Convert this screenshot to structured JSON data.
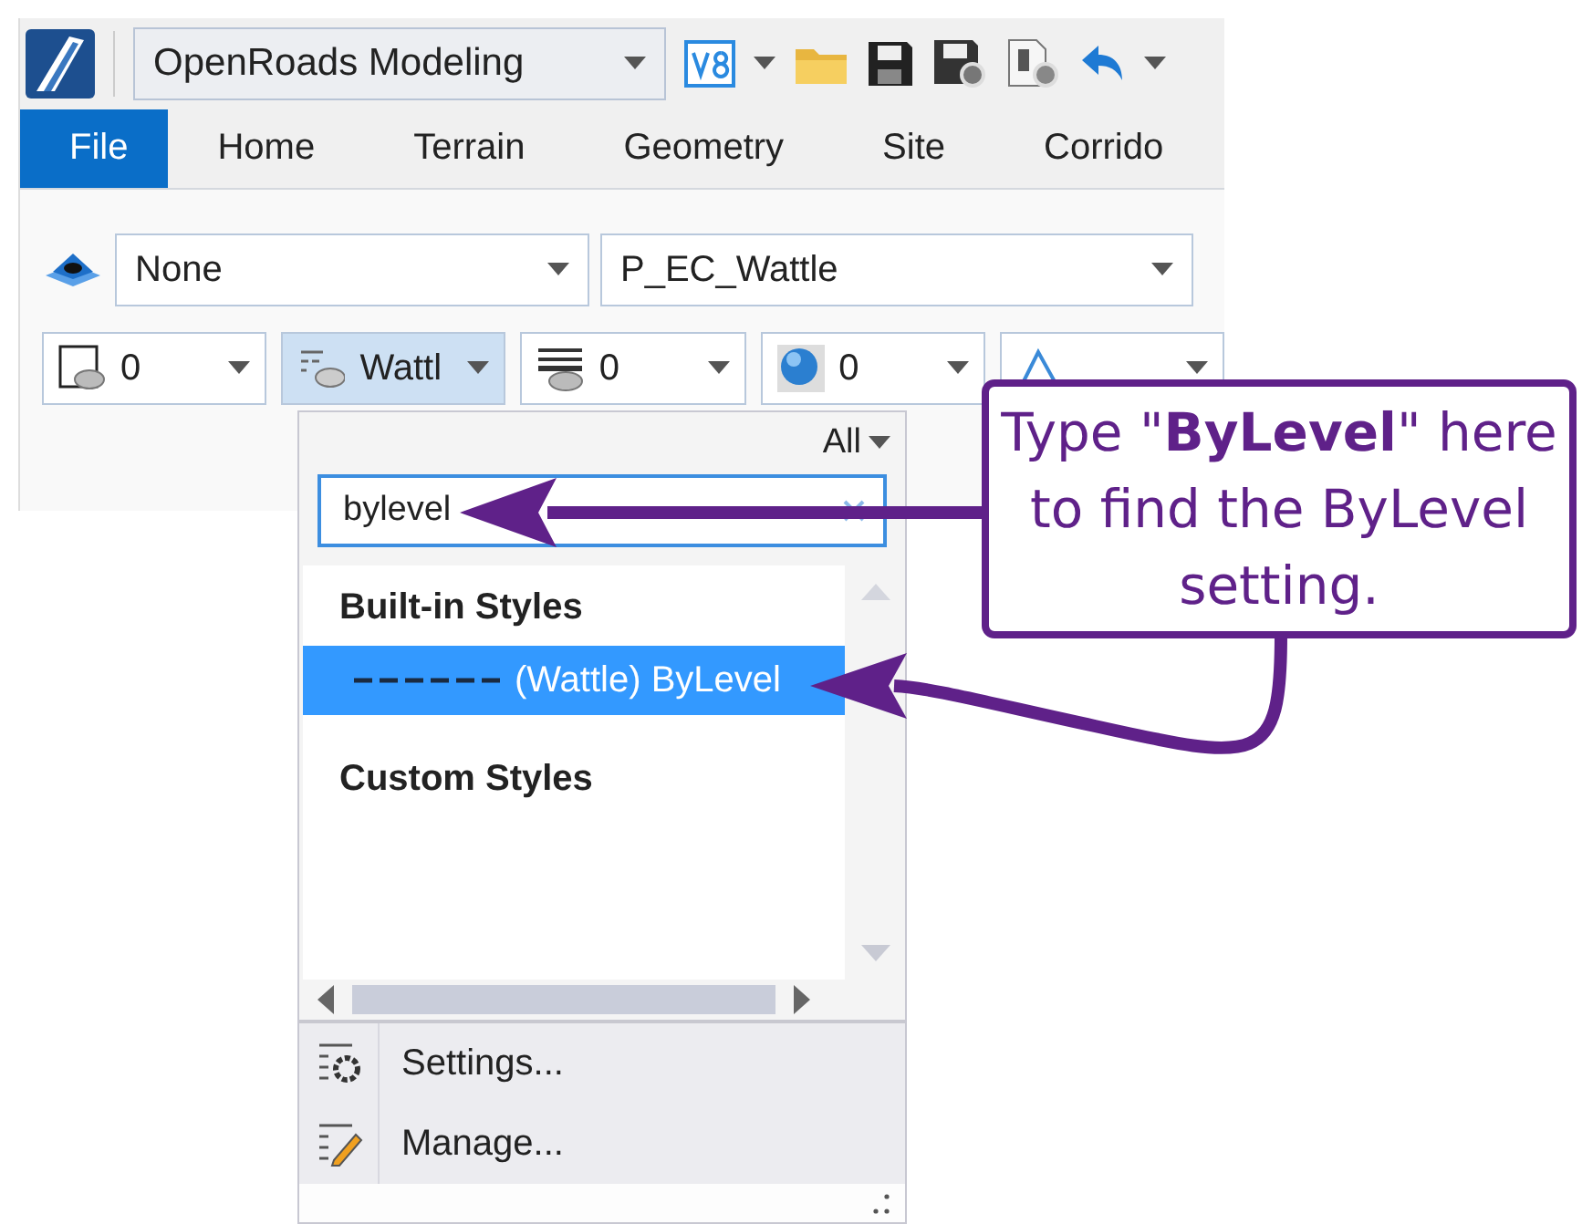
{
  "toolbar": {
    "workflow": "OpenRoads Modeling"
  },
  "tabs": [
    {
      "label": "File",
      "selected": true
    },
    {
      "label": "Home",
      "selected": false
    },
    {
      "label": "Terrain",
      "selected": false
    },
    {
      "label": "Geometry",
      "selected": false
    },
    {
      "label": "Site",
      "selected": false
    },
    {
      "label": "Corrido",
      "selected": false
    }
  ],
  "attributes": {
    "level": "None",
    "template": "P_EC_Wattle",
    "symbology": [
      {
        "kind": "color",
        "value": "0",
        "open": false
      },
      {
        "kind": "style",
        "value": "Wattl",
        "open": true
      },
      {
        "kind": "weight",
        "value": "0",
        "open": false
      },
      {
        "kind": "transparency",
        "value": "0",
        "open": false
      },
      {
        "kind": "priority",
        "open": false
      }
    ]
  },
  "style_popup": {
    "filter": "All",
    "search": {
      "value": "bylevel"
    },
    "groups": [
      {
        "title": "Built-in Styles",
        "items": [
          {
            "label": "(Wattle) ByLevel",
            "selected": true
          }
        ]
      },
      {
        "title": "Custom Styles"
      }
    ],
    "actions": [
      {
        "label": "Settings...",
        "kind": "settings"
      },
      {
        "label": "Manage...",
        "kind": "manage"
      }
    ]
  },
  "callout": {
    "text": "Type \"**ByLevel**\" here to find the ByLevel setting."
  }
}
